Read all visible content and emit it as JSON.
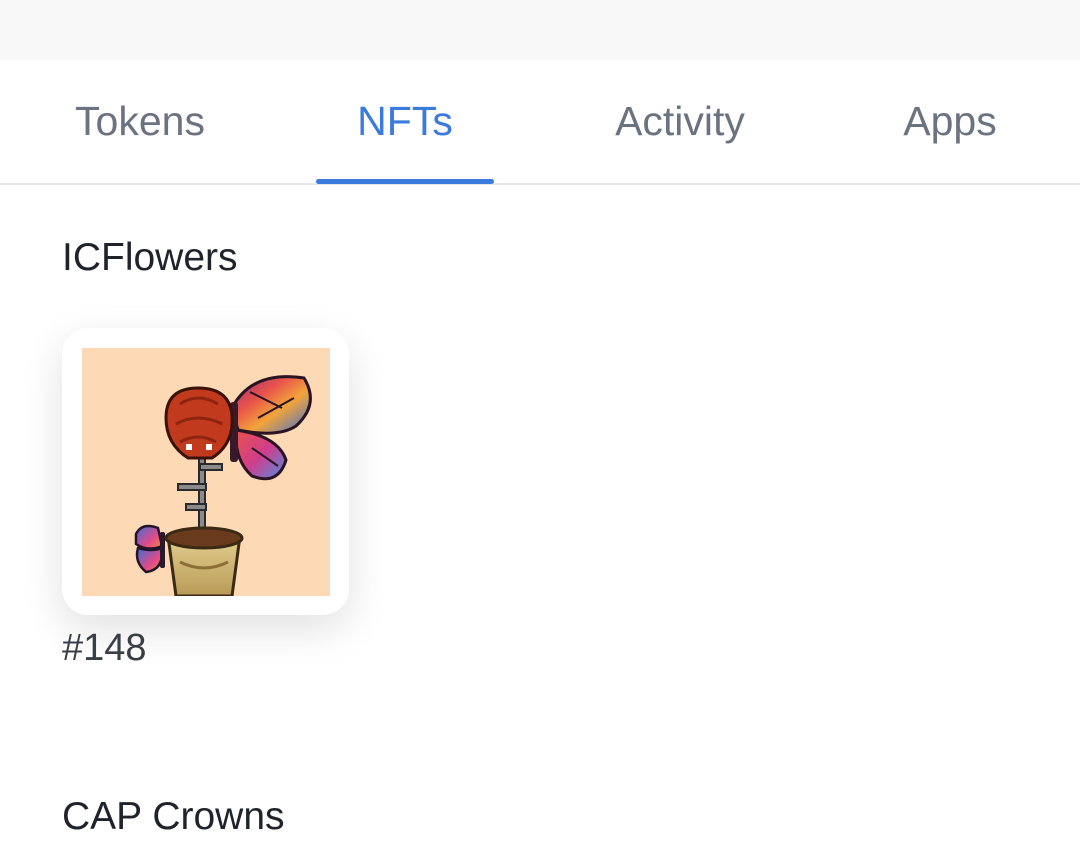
{
  "tabs": [
    {
      "label": "Tokens",
      "active": false
    },
    {
      "label": "NFTs",
      "active": true
    },
    {
      "label": "Activity",
      "active": false
    },
    {
      "label": "Apps",
      "active": false
    }
  ],
  "colors": {
    "accent": "#3a7bdd",
    "tab_inactive": "#6b7380",
    "art_background": "#fdd9b6"
  },
  "collections": [
    {
      "name": "ICFlowers",
      "items": [
        {
          "id": "#148",
          "art": "flower-with-butterflies-icon"
        }
      ]
    },
    {
      "name": "CAP Crowns",
      "items": []
    }
  ]
}
